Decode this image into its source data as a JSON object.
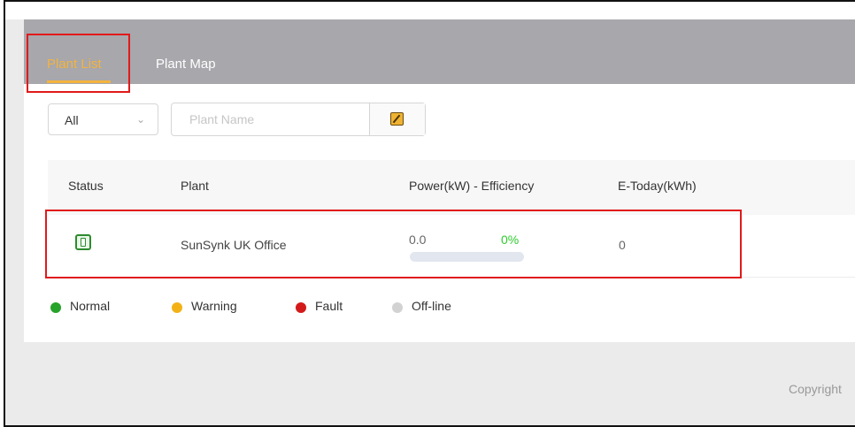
{
  "tabs": [
    {
      "label": "Plant List",
      "active": true
    },
    {
      "label": "Plant Map",
      "active": false
    }
  ],
  "filter": {
    "status_select": {
      "value": "All",
      "icon": "chevron-down-icon"
    },
    "plant_name": {
      "placeholder": "Plant Name",
      "value": ""
    },
    "search_button_icon": "search-icon"
  },
  "table": {
    "headers": [
      "Status",
      "Plant",
      "Power(kW) - Efficiency",
      "E-Today(kWh)"
    ],
    "rows": [
      {
        "status_icon": "inverter-online-icon",
        "plant": "SunSynk UK Office",
        "power": "0.0",
        "efficiency": "0%",
        "efficiency_fraction": 0,
        "e_today": "0"
      }
    ]
  },
  "legend": [
    {
      "label": "Normal",
      "color": "#27a22a"
    },
    {
      "label": "Warning",
      "color": "#f2b216"
    },
    {
      "label": "Fault",
      "color": "#d31a1a"
    },
    {
      "label": "Off-line",
      "color": "#d2d2d2"
    }
  ],
  "footer": {
    "copyright": "Copyright"
  },
  "colors": {
    "header_bg": "#a7a7ac",
    "accent": "#f3b33f",
    "efficiency_green": "#2ecc2e",
    "highlight_red": "#e11a1a"
  }
}
